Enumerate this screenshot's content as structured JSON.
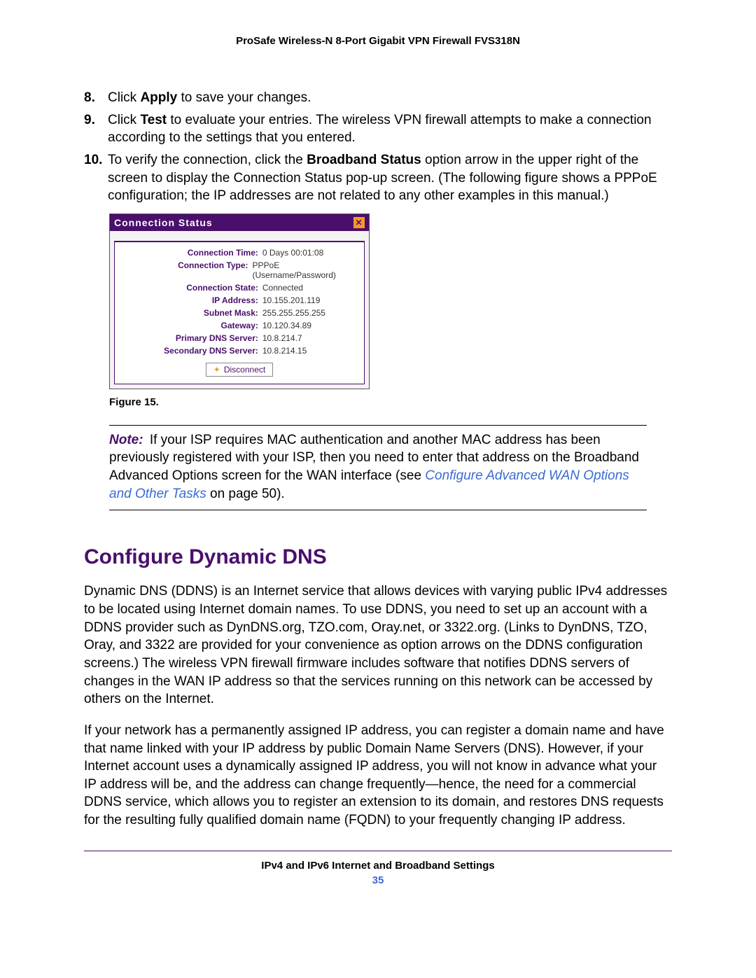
{
  "header": {
    "title": "ProSafe Wireless-N 8-Port Gigabit VPN Firewall FVS318N"
  },
  "steps": {
    "s8": {
      "num": "8.",
      "pre": "Click ",
      "bold": "Apply",
      "post": " to save your changes."
    },
    "s9": {
      "num": "9.",
      "pre": "Click ",
      "bold": "Test",
      "post": " to evaluate your entries. The wireless VPN firewall attempts to make a connection according to the settings that you entered."
    },
    "s10": {
      "num": "10.",
      "pre": "To verify the connection, click the ",
      "bold": "Broadband Status",
      "post": " option arrow in the upper right of the screen to display the Connection Status pop-up screen. (The following figure shows a PPPoE configuration; the IP addresses are not related to any other examples in this manual.)"
    }
  },
  "popup": {
    "title": "Connection Status",
    "close_glyph": "✕",
    "rows": [
      {
        "label": "Connection Time:",
        "value": "0 Days 00:01:08"
      },
      {
        "label": "Connection Type:",
        "value": "PPPoE (Username/Password)"
      },
      {
        "label": "Connection State:",
        "value": "Connected"
      },
      {
        "label": "IP Address:",
        "value": "10.155.201.119"
      },
      {
        "label": "Subnet Mask:",
        "value": "255.255.255.255"
      },
      {
        "label": "Gateway:",
        "value": "10.120.34.89"
      },
      {
        "label": "Primary DNS Server:",
        "value": "10.8.214.7"
      },
      {
        "label": "Secondary DNS Server:",
        "value": "10.8.214.15"
      }
    ],
    "button_label": "Disconnect"
  },
  "figure_caption": "Figure 15.",
  "note": {
    "label": "Note:",
    "text_before_link": "If your ISP requires MAC authentication and another MAC address has been previously registered with your ISP, then you need to enter that address on the Broadband Advanced Options screen for the WAN interface (see ",
    "link_text": "Configure Advanced WAN Options and Other Tasks",
    "text_after_link": " on page 50)."
  },
  "section": {
    "heading": "Configure Dynamic DNS",
    "para1": "Dynamic DNS (DDNS) is an Internet service that allows devices with varying public IPv4 addresses to be located using Internet domain names. To use DDNS, you need to set up an account with a DDNS provider such as DynDNS.org, TZO.com, Oray.net, or 3322.org. (Links to DynDNS, TZO, Oray, and 3322 are provided for your convenience as option arrows on the DDNS configuration screens.) The wireless VPN firewall firmware includes software that notifies DDNS servers of changes in the WAN IP address so that the services running on this network can be accessed by others on the Internet.",
    "para2": "If your network has a permanently assigned IP address, you can register a domain name and have that name linked with your IP address by public Domain Name Servers (DNS). However, if your Internet account uses a dynamically assigned IP address, you will not know in advance what your IP address will be, and the address can change frequently—hence, the need for a commercial DDNS service, which allows you to register an extension to its domain, and restores DNS requests for the resulting fully qualified domain name (FQDN) to your frequently changing IP address."
  },
  "footer": {
    "line1": "IPv4 and IPv6 Internet and Broadband Settings",
    "page": "35"
  }
}
